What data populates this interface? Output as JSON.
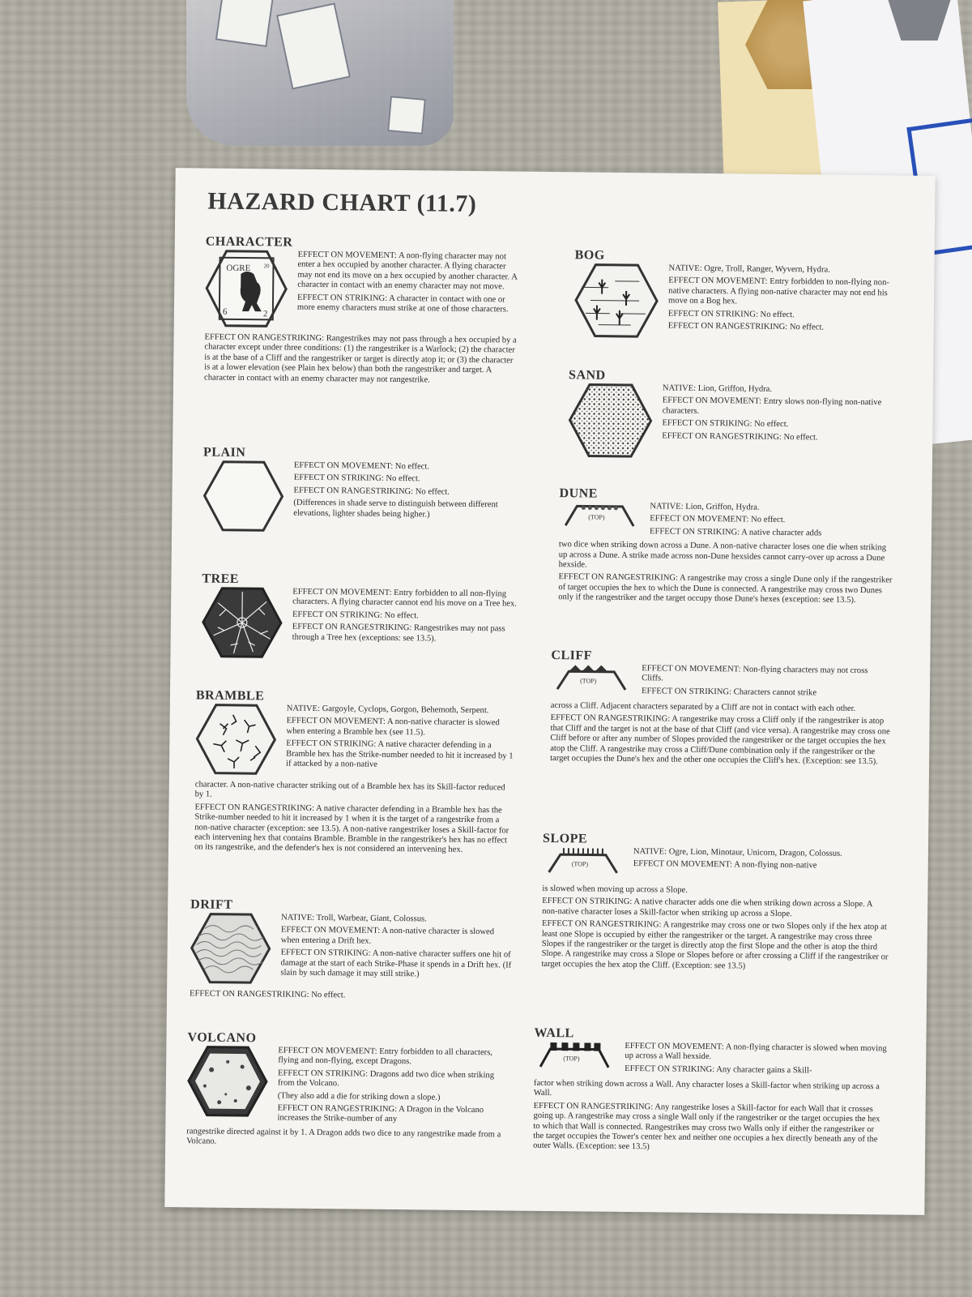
{
  "title": "HAZARD CHART (11.7)",
  "left": [
    {
      "name": "CHARACTER",
      "icon": "ogre-counter-icon",
      "counter": {
        "name": "OGRE",
        "tl": "6",
        "br": "2",
        "corner": "20"
      },
      "lines": [
        "EFFECT ON MOVEMENT: A non-flying character may not enter a hex occupied by another character. A flying character may not end its move on a hex occupied by another character. A character in contact with an enemy character may not move.",
        "EFFECT ON STRIKING: A character in contact with one or more enemy characters must strike at one of those characters."
      ],
      "full": [
        "EFFECT ON RANGESTRIKING: Rangestrikes may not pass through a hex occupied by a character except under three conditions: (1) the rangestriker is a Warlock; (2) the character is at the base of a Cliff and the rangestriker or target is directly atop it; or (3) the character is at a lower elevation (see Plain hex below) than both the rangestriker and target. A character in contact with an enemy character may not rangestrike."
      ]
    },
    {
      "name": "PLAIN",
      "icon": "plain-hex-icon",
      "lines": [
        "EFFECT ON MOVEMENT: No effect.",
        "EFFECT ON STRIKING: No effect.",
        "EFFECT ON RANGESTRIKING: No effect.",
        "(Differences in shade serve to distinguish between different elevations, lighter shades being higher.)"
      ],
      "full": []
    },
    {
      "name": "TREE",
      "icon": "tree-hex-icon",
      "lines": [
        "EFFECT ON MOVEMENT: Entry forbidden to all non-flying characters. A flying character cannot end his move on a Tree hex.",
        "EFFECT ON STRIKING: No effect.",
        "EFFECT ON RANGESTRIKING: Rangestrikes may not pass through a Tree hex (exceptions: see 13.5)."
      ],
      "full": []
    },
    {
      "name": "BRAMBLE",
      "icon": "bramble-hex-icon",
      "lines": [
        "NATIVE: Gargoyle, Cyclops, Gorgon, Behemoth, Serpent.",
        "EFFECT ON MOVEMENT: A non-native character is slowed when entering a Bramble hex (see 11.5).",
        "EFFECT ON STRIKING: A native character defending in a Bramble hex has the Strike-number needed to hit it increased by 1 if attacked by a non-native"
      ],
      "full": [
        "character. A non-native character striking out of a Bramble hex has its Skill-factor reduced by 1.",
        "EFFECT ON RANGESTRIKING: A native character defending in a Bramble hex has the Strike-number needed to hit it increased by 1 when it is the target of a rangestrike from a non-native character (exception: see 13.5). A non-native rangestriker loses a Skill-factor for each intervening hex that contains Bramble. Bramble in the rangestriker's hex has no effect on its rangestrike, and the defender's hex is not considered an intervening hex."
      ]
    },
    {
      "name": "DRIFT",
      "icon": "drift-hex-icon",
      "lines": [
        "NATIVE: Troll, Warbear, Giant, Colossus.",
        "EFFECT ON MOVEMENT: A non-native character is slowed when entering a Drift hex.",
        "EFFECT ON STRIKING: A non-native character suffers one hit of damage at the start of each Strike-Phase it spends in a Drift hex. (If slain by such damage it may still strike.)"
      ],
      "full": [
        "EFFECT ON RANGESTRIKING: No effect."
      ]
    },
    {
      "name": "VOLCANO",
      "icon": "volcano-hex-icon",
      "lines": [
        "EFFECT ON MOVEMENT: Entry forbidden to all characters, flying and non-flying, except Dragons.",
        "EFFECT ON STRIKING: Dragons add two dice when striking from the Volcano.",
        "(They also add a die for striking down a slope.)",
        "EFFECT ON RANGESTRIKING: A Dragon in the Volcano increases the Strike-number of any"
      ],
      "full": [
        "rangestrike directed against it by 1. A Dragon adds two dice to any rangestrike made from a Volcano."
      ]
    }
  ],
  "right": [
    {
      "name": "BOG",
      "icon": "bog-hex-icon",
      "lines": [
        "NATIVE: Ogre, Troll, Ranger, Wyvern, Hydra.",
        "EFFECT ON MOVEMENT: Entry forbidden to non-flying non-native characters. A flying non-native character may not end his move on a Bog hex.",
        "EFFECT ON STRIKING: No effect.",
        "EFFECT ON RANGESTRIKING: No effect."
      ],
      "full": []
    },
    {
      "name": "SAND",
      "icon": "sand-hex-icon",
      "lines": [
        "NATIVE: Lion, Griffon, Hydra.",
        "EFFECT ON MOVEMENT: Entry slows non-flying non-native characters.",
        "EFFECT ON STRIKING: No effect.",
        "EFFECT ON RANGESTRIKING: No effect."
      ],
      "full": []
    },
    {
      "name": "DUNE",
      "icon": "dune-hexside-icon",
      "top_label": "(TOP)",
      "lines": [
        "NATIVE: Lion, Griffon, Hydra.",
        "EFFECT ON MOVEMENT: No effect.",
        "EFFECT ON STRIKING: A native character adds"
      ],
      "full": [
        "two dice when striking down across a Dune. A non-native character loses one die when striking up across a Dune. A strike made across non-Dune hexsides cannot carry-over up across a Dune hexside.",
        "EFFECT ON RANGESTRIKING: A rangestrike may cross a single Dune only if the rangestriker of target occupies the hex to which the Dune is connected. A rangestrike may cross two Dunes only if the rangestriker and the target occupy those Dune's hexes (exception: see 13.5)."
      ]
    },
    {
      "name": "CLIFF",
      "icon": "cliff-hexside-icon",
      "top_label": "(TOP)",
      "lines": [
        "EFFECT ON MOVEMENT: Non-flying characters may not cross Cliffs.",
        "EFFECT ON STRIKING: Characters cannot strike"
      ],
      "full": [
        "across a Cliff. Adjacent characters separated by a Cliff are not in contact with each other.",
        "EFFECT ON RANGESTRIKING: A rangestrike may cross a Cliff only if the rangestriker is atop that Cliff and the target is not at the base of that Cliff (and vice versa). A rangestrike may cross one Cliff before or after any number of Slopes provided the rangestriker or the target occupies the hex atop the Cliff. A rangestrike may cross a Cliff/Dune combination only if the rangestriker or the target occupies the Dune's hex and the other one occupies the Cliff's hex. (Exception: see 13.5)."
      ]
    },
    {
      "name": "SLOPE",
      "icon": "slope-hexside-icon",
      "top_label": "(TOP)",
      "lines": [
        "NATIVE: Ogre, Lion, Minotaur, Unicorn, Dragon, Colossus.",
        "EFFECT ON MOVEMENT: A non-flying non-native"
      ],
      "full": [
        "is slowed when moving up across a Slope.",
        "EFFECT ON STRIKING: A native character adds one die when striking down across a Slope. A non-native character loses a Skill-factor when striking up across a Slope.",
        "EFFECT ON RANGESTRIKING: A rangestrike may cross one or two Slopes only if the hex atop at least one Slope is occupied by either the rangestriker or the target. A rangestrike may cross three Slopes if the rangestriker or the target is directly atop the first Slope and the other is atop the third Slope. A rangestrike may cross a Slope or Slopes before or after crossing a Cliff if the rangestriker or target occupies the hex atop the Cliff. (Exception: see 13.5)"
      ]
    },
    {
      "name": "WALL",
      "icon": "wall-hexside-icon",
      "top_label": "(TOP)",
      "lines": [
        "EFFECT ON MOVEMENT: A non-flying character is slowed when moving up across a Wall hexside.",
        "EFFECT ON STRIKING: Any character gains a Skill-"
      ],
      "full": [
        "factor when striking down across a Wall. Any character loses a Skill-factor when striking up across a Wall.",
        "EFFECT ON RANGESTRIKING: Any rangestrike loses a Skill-factor for each Wall that it crosses going up. A rangestrike may cross a single Wall only if the rangestriker or the target occupies the hex to which that Wall is connected. Rangestrikes may cross two Walls only if either the rangestriker or the target occupies the Tower's center hex and neither one occupies a hex directly beneath any of the outer Walls. (Exception: see 13.5)"
      ]
    }
  ]
}
